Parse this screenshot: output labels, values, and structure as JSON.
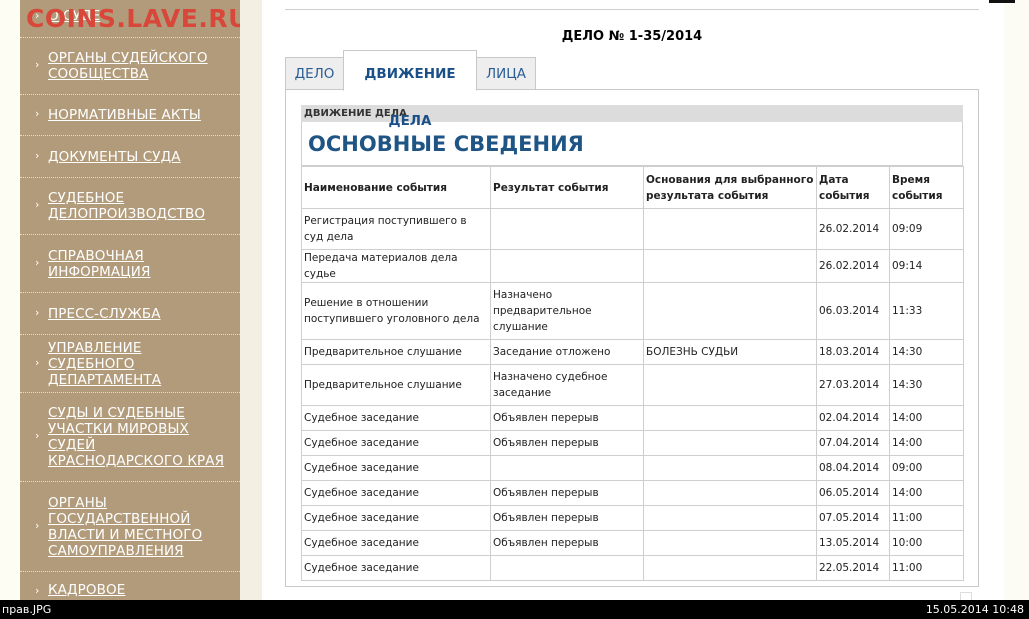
{
  "watermark": "COINS.LAVE.RU",
  "sidebar": {
    "items": [
      {
        "label": "О СУДЕ"
      },
      {
        "label": "ОРГАНЫ СУДЕЙСКОГО СООБЩЕСТВА"
      },
      {
        "label": "НОРМАТИВНЫЕ АКТЫ"
      },
      {
        "label": "ДОКУМЕНТЫ СУДА"
      },
      {
        "label": "СУДЕБНОЕ ДЕЛОПРОИЗВОДСТВО"
      },
      {
        "label": "СПРАВОЧНАЯ ИНФОРМАЦИЯ"
      },
      {
        "label": "ПРЕСС-СЛУЖБА"
      },
      {
        "label": "УПРАВЛЕНИЕ СУДЕБНОГО ДЕПАРТАМЕНТА"
      },
      {
        "label": "СУДЫ И СУДЕБНЫЕ УЧАСТКИ МИРОВЫХ СУДЕЙ КРАСНОДАРСКОГО КРАЯ"
      },
      {
        "label": "ОРГАНЫ ГОСУДАРСТВЕННОЙ ВЛАСТИ И МЕСТНОГО САМОУПРАВЛЕНИЯ"
      },
      {
        "label": "КАДРОВОЕ ОБЕСПЕЧЕНИЕ СУДА"
      }
    ]
  },
  "case_title": "ДЕЛО № 1-35/2014",
  "tabs": [
    {
      "label": "ДЕЛО"
    },
    {
      "label": "ДВИЖЕНИЕ ДЕЛА"
    },
    {
      "label": "ЛИЦА"
    }
  ],
  "section_label": "ДВИЖЕНИЕ ДЕЛА",
  "section_heading": "ОСНОВНЫЕ СВЕДЕНИЯ",
  "table": {
    "headers": [
      "Наименование события",
      "Результат события",
      "Основания для выбранного результата события",
      "Дата события",
      "Время события"
    ],
    "rows": [
      [
        "Регистрация поступившего в суд дела",
        "",
        "",
        "26.02.2014",
        "09:09"
      ],
      [
        "Передача материалов дела судье",
        "",
        "",
        "26.02.2014",
        "09:14"
      ],
      [
        "Решение в отношении поступившего уголовного дела",
        "Назначено предварительное слушание",
        "",
        "06.03.2014",
        "11:33"
      ],
      [
        "Предварительное слушание",
        "Заседание отложено",
        "БОЛЕЗНЬ СУДЬИ",
        "18.03.2014",
        "14:30"
      ],
      [
        "Предварительное слушание",
        "Назначено судебное заседание",
        "",
        "27.03.2014",
        "14:30"
      ],
      [
        "Судебное заседание",
        "Объявлен перерыв",
        "",
        "02.04.2014",
        "14:00"
      ],
      [
        "Судебное заседание",
        "Объявлен перерыв",
        "",
        "07.04.2014",
        "14:00"
      ],
      [
        "Судебное заседание",
        "",
        "",
        "08.04.2014",
        "09:00"
      ],
      [
        "Судебное заседание",
        "Объявлен перерыв",
        "",
        "06.05.2014",
        "14:00"
      ],
      [
        "Судебное заседание",
        "Объявлен перерыв",
        "",
        "07.05.2014",
        "11:00"
      ],
      [
        "Судебное заседание",
        "Объявлен перерыв",
        "",
        "13.05.2014",
        "10:00"
      ],
      [
        "Судебное заседание",
        "",
        "",
        "22.05.2014",
        "11:00"
      ]
    ]
  },
  "status_bar": {
    "filename": "прав.JPG",
    "timestamp": "15.05.2014 10:48"
  }
}
